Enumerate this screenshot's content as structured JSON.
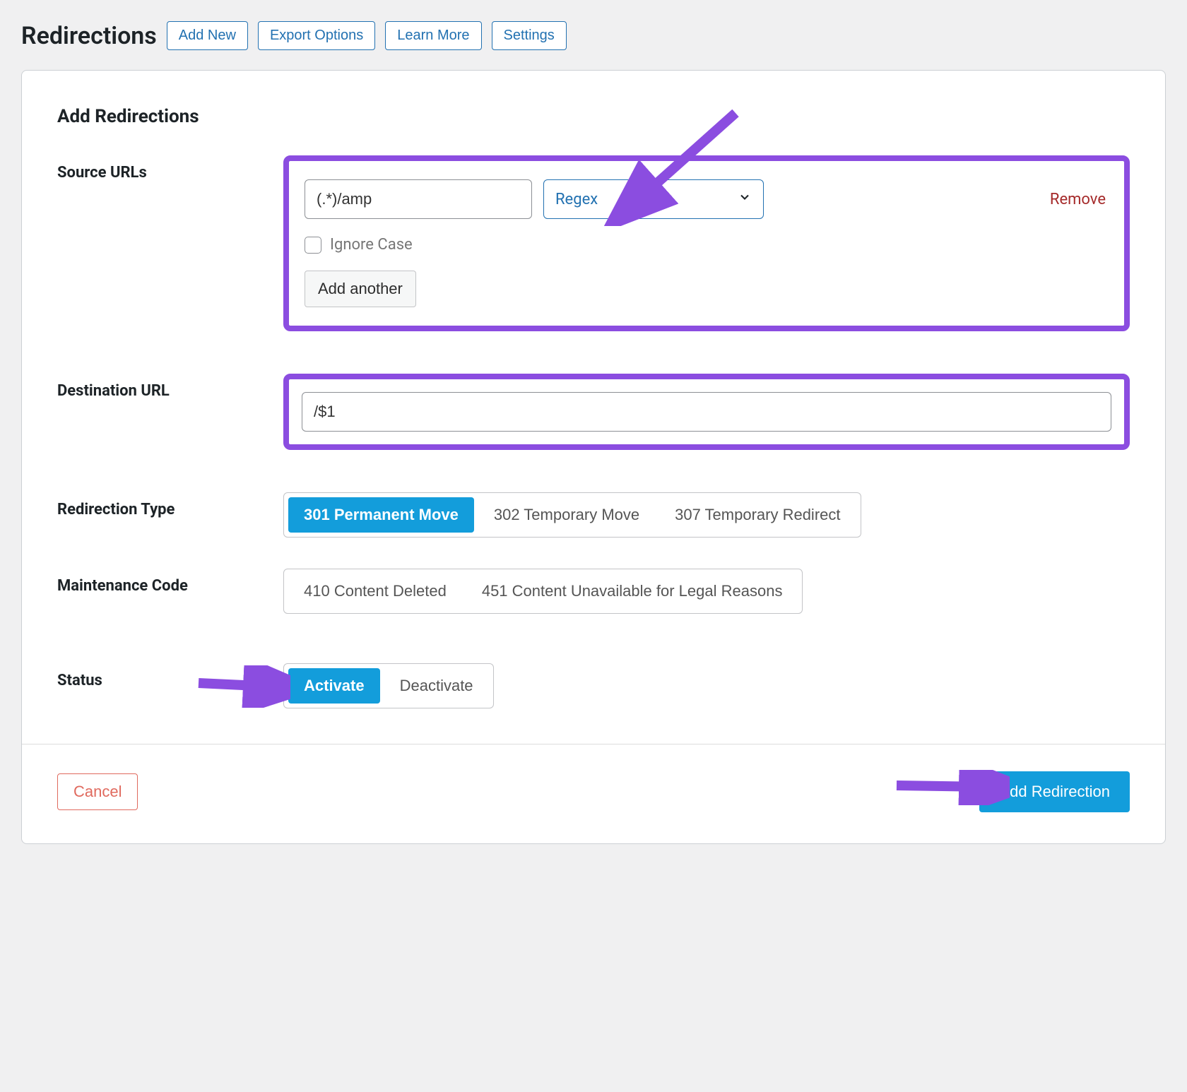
{
  "header": {
    "title": "Redirections",
    "buttons": {
      "add_new": "Add New",
      "export_options": "Export Options",
      "learn_more": "Learn More",
      "settings": "Settings"
    }
  },
  "section": {
    "title": "Add Redirections"
  },
  "source": {
    "label": "Source URLs",
    "value": "(.*)/amp",
    "match_type": "Regex",
    "remove": "Remove",
    "ignore_case": "Ignore Case",
    "add_another": "Add another"
  },
  "destination": {
    "label": "Destination URL",
    "value": "/$1"
  },
  "redirection_type": {
    "label": "Redirection Type",
    "options": {
      "r301": "301 Permanent Move",
      "r302": "302 Temporary Move",
      "r307": "307 Temporary Redirect"
    }
  },
  "maintenance": {
    "label": "Maintenance Code",
    "options": {
      "m410": "410 Content Deleted",
      "m451": "451 Content Unavailable for Legal Reasons"
    }
  },
  "status": {
    "label": "Status",
    "activate": "Activate",
    "deactivate": "Deactivate"
  },
  "footer": {
    "cancel": "Cancel",
    "submit": "Add Redirection"
  }
}
